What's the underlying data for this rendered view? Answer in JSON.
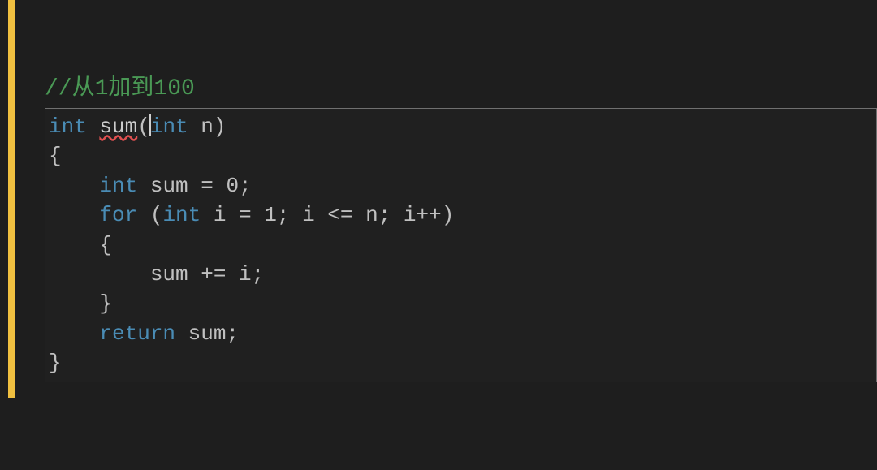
{
  "comment": "//从1加到100",
  "code": {
    "line1": {
      "kw_int": "int",
      "fn_name": "sum",
      "paren_open": "(",
      "param_type": "int",
      "param_name": " n",
      "paren_close": ")"
    },
    "line2": "{",
    "line3": {
      "indent": "    ",
      "kw_int": "int",
      "rest": " sum = 0;"
    },
    "line4": {
      "indent": "    ",
      "kw_for": "for",
      "paren_open": " (",
      "kw_int": "int",
      "rest": " i = 1; i <= n; i++)"
    },
    "line5": "    {",
    "line6": "        sum += i;",
    "line7": "    }",
    "line8": {
      "indent": "    ",
      "kw_return": "return",
      "rest": " sum;"
    },
    "line9": "}"
  }
}
